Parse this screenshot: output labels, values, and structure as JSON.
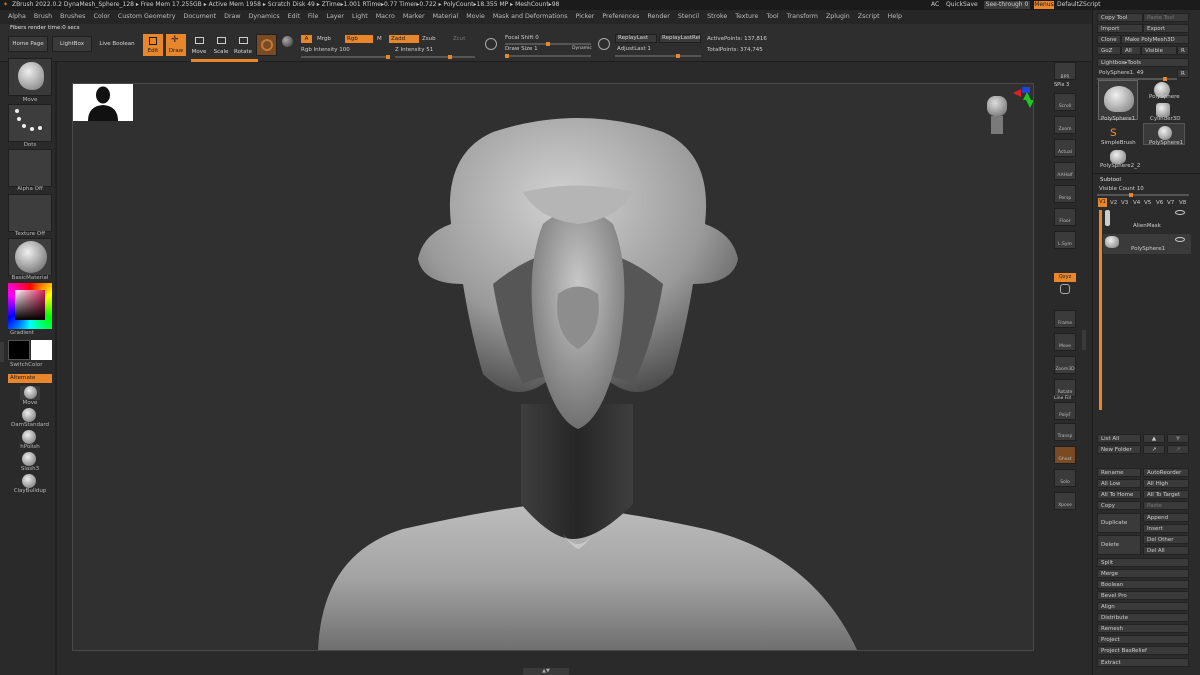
{
  "titlebar": {
    "text": "ZBrush 2022.0.2   DynaMesh_Sphere_128   ▸ Free Mem 17.255GB ▸ Active Mem 1958 ▸ Scratch Disk 49 ▸ ZTime▸1.001 RTime▸0.77 Timer▸0.722 ▸ PolyCount▸18.355 MP ▸ MeshCount▸98",
    "ac": "AC",
    "quicksave": "QuickSave",
    "seethrough": "See-through  0",
    "menus": "Menus",
    "script": "DefaultZScript"
  },
  "menubar": [
    "Alpha",
    "Brush",
    "Brushes",
    "Color",
    "Custom Geometry",
    "Document",
    "Draw",
    "Dynamics",
    "Edit",
    "File",
    "Layer",
    "Light",
    "Macro",
    "Marker",
    "Material",
    "Movie",
    "Mask and Deformations",
    "Picker",
    "Preferences",
    "Render",
    "Stencil",
    "Stroke",
    "Texture",
    "Tool",
    "Transform",
    "Zplugin",
    "Zscript",
    "Help"
  ],
  "status": "Fibers render time:0 secs",
  "toolbar": {
    "home": "Home Page",
    "lightbox": "LightBox",
    "liveboolean": "Live Boolean",
    "edit": "Edit",
    "draw": "Draw",
    "move": "Move",
    "scale": "Scale",
    "rotate": "Rotate",
    "a": "A",
    "mrgb": "Mrgb",
    "rgb": "Rgb",
    "m": "M",
    "zadd": "Zadd",
    "zsub": "Zsub",
    "zcut": "Zcut",
    "rgb_intensity": "Rgb Intensity 100",
    "z_intensity": "Z Intensity 51",
    "focal_shift": "Focal Shift 0",
    "draw_size": "Draw Size 1",
    "dynamic": "Dynamic",
    "replaylast": "ReplayLast",
    "replaylastrel": "ReplayLastRel",
    "adjustlast": "AdjustLast 1",
    "activepoints": "ActivePoints: 137,816",
    "totalpoints": "TotalPoints: 374,745"
  },
  "left": {
    "move": "Move",
    "dots": "Dots",
    "alpha": "Alpha Off",
    "texture": "Texture Off",
    "material": "BasicMaterial",
    "gradient": "Gradient",
    "switchcolor": "SwitchColor",
    "alternate": "Alternate",
    "brushes": [
      "Move",
      "DamStandard",
      "hPolish",
      "Slash3",
      "ClayBuildup"
    ]
  },
  "shelf": [
    "BPR",
    "SPix 3",
    "Scroll",
    "Zoom",
    "Actual",
    "AAHalf",
    "Persp",
    "Floor",
    "L.Sym",
    "Qxyz",
    "Frame",
    "Move",
    "Zoom3D",
    "Rotate",
    "Line Fill",
    "PolyF",
    "Transp",
    "Ghost",
    "Solo",
    "Xpose"
  ],
  "panel": {
    "copytool": "Copy Tool",
    "pastetool": "Paste Tool",
    "import": "Import",
    "export": "Export",
    "clone": "Clone",
    "makepm": "Make PolyMesh3D",
    "goz": "GoZ",
    "all": "All",
    "visible": "Visible",
    "r": "R",
    "lightboxtools": "Lightbox▸Tools",
    "polysphere49": "PolySphere1. 49",
    "r2": "R",
    "tools": [
      "PolySphere1",
      "PolySphere",
      "Cylinder3D",
      "SimpleBrush",
      "PolySphere1",
      "PolySphere2_2"
    ],
    "subtool": "Subtool",
    "visiblecount": "Visible Count 10",
    "vtabs": [
      "V1",
      "V2",
      "V3",
      "V4",
      "V5",
      "V6",
      "V7",
      "V8"
    ],
    "sub1": "AlienMask",
    "sub2": "PolySphere1",
    "listall": "List All",
    "newfolder": "New Folder",
    "rename": "Rename",
    "autoreorder": "AutoReorder",
    "alllow": "All Low",
    "allhigh": "All High",
    "alltohome": "All To Home",
    "alltotarget": "All To Target",
    "copy": "Copy",
    "paste": "Paste",
    "append": "Append",
    "duplicate": "Duplicate",
    "insert": "Insert",
    "delete": "Delete",
    "delother": "Del Other",
    "delall": "Del All",
    "sections": [
      "Split",
      "Merge",
      "Boolean",
      "Bevel Pro",
      "Align",
      "Distribute",
      "Remesh",
      "Project",
      "Project BasRelief",
      "Extract"
    ]
  },
  "colors": {
    "accent": "#e8862c",
    "bg": "#2a2a2a",
    "viewport": "#303030"
  }
}
